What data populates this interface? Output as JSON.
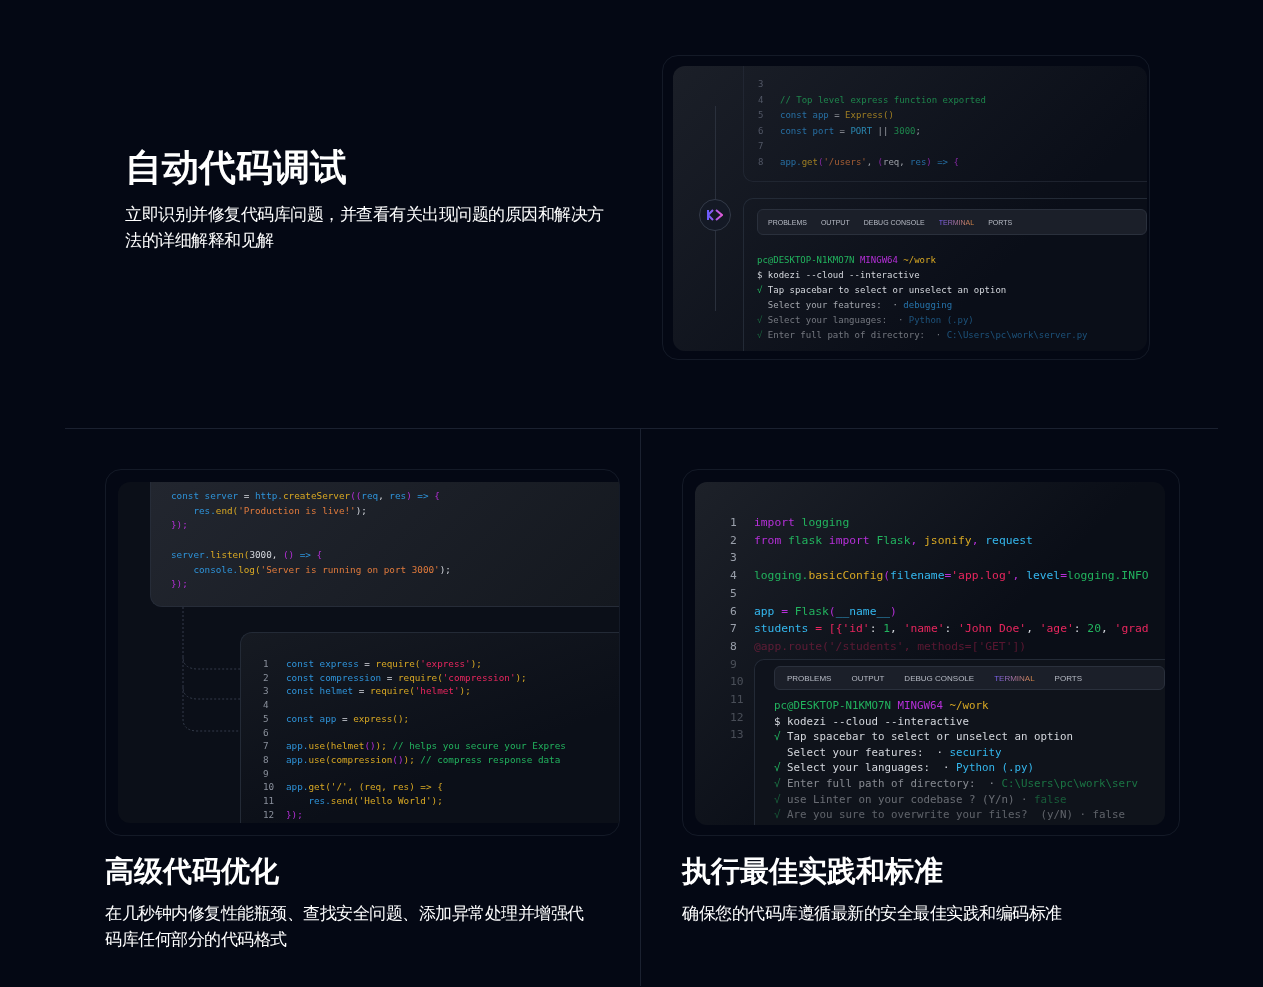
{
  "debugging": {
    "title": "自动代码调试",
    "description": "立即识别并修复代码库问题，并查看有关出现问题的原因和解决方法的详细解释和见解",
    "editor": {
      "lines": [
        {
          "number": "3"
        },
        {
          "number": "4",
          "tokens": [
            {
              "text": "// Top level express function exported",
              "kind": "comment"
            }
          ]
        },
        {
          "number": "5",
          "tokens": [
            {
              "text": "const app",
              "kind": "keyword"
            },
            {
              "text": " = ",
              "kind": "plain"
            },
            {
              "text": "Express()",
              "kind": "call"
            }
          ]
        },
        {
          "number": "6",
          "tokens": [
            {
              "text": "const port",
              "kind": "keyword"
            },
            {
              "text": " = ",
              "kind": "plain"
            },
            {
              "text": "PORT",
              "kind": "variable"
            },
            {
              "text": " || ",
              "kind": "plain"
            },
            {
              "text": "3000",
              "kind": "comment"
            },
            {
              "text": ";",
              "kind": "plain"
            }
          ]
        },
        {
          "number": "7"
        },
        {
          "number": "8",
          "tokens": [
            {
              "text": "app.",
              "kind": "keyword"
            },
            {
              "text": "get",
              "kind": "call"
            },
            {
              "text": "(",
              "kind": "bracket"
            },
            {
              "text": "'/users'",
              "kind": "string"
            },
            {
              "text": ", ",
              "kind": "plain"
            },
            {
              "text": "(",
              "kind": "bracket"
            },
            {
              "text": "req, ",
              "kind": "plain"
            },
            {
              "text": "res",
              "kind": "keyword"
            },
            {
              "text": ") ",
              "kind": "bracket"
            },
            {
              "text": "=> ",
              "kind": "keyword"
            },
            {
              "text": "{",
              "kind": "bracket"
            }
          ]
        }
      ]
    },
    "terminal": {
      "tabs": [
        {
          "label": "PROBLEMS",
          "selected": false
        },
        {
          "label": "OUTPUT",
          "selected": false
        },
        {
          "label": "DEBUG CONSOLE",
          "selected": false
        },
        {
          "label": "TERMINAL",
          "selected": true
        },
        {
          "label": "PORTS",
          "selected": false
        }
      ],
      "lines": [
        {
          "tokens": [
            {
              "text": "pc@DESKTOP-N1KMO7N ",
              "kind": "comment"
            },
            {
              "text": "MINGW64 ",
              "kind": "bracket"
            },
            {
              "text": "~/work",
              "kind": "call"
            }
          ]
        },
        {
          "tokens": [
            {
              "text": "$ kodezi --cloud --interactive",
              "kind": "plain"
            }
          ]
        },
        {
          "tokens": [
            {
              "text": "√ ",
              "kind": "comment"
            },
            {
              "text": "Tap spacebar to select or unselect an option",
              "kind": "plain"
            }
          ]
        },
        {
          "tokens": [
            {
              "text": "  Select your features:  · ",
              "kind": "plain"
            },
            {
              "text": "debugging",
              "kind": "keyword"
            }
          ]
        },
        {
          "tokens": [
            {
              "text": "√ ",
              "kind": "comment"
            },
            {
              "text": "Select your languages:  · ",
              "kind": "plain"
            },
            {
              "text": "Python (.py)",
              "kind": "keyword"
            }
          ]
        },
        {
          "tokens": [
            {
              "text": "√ ",
              "kind": "comment"
            },
            {
              "text": "Enter full path of directory:  · ",
              "kind": "plain"
            },
            {
              "text": "C:\\Users\\pc\\work\\server.py",
              "kind": "keyword"
            }
          ]
        }
      ]
    }
  },
  "optimization": {
    "title": "高级代码优化",
    "description": "在几秒钟内修复性能瓶颈、查找安全问题、添加异常处理并增强代码库任何部分的代码格式",
    "server_snippet": {
      "blocks": [
        {
          "lines": [
            {
              "tokens": [
                {
                  "text": "const server",
                  "kind": "keyword"
                },
                {
                  "text": " = ",
                  "kind": "plain"
                },
                {
                  "text": "http.",
                  "kind": "keyword"
                },
                {
                  "text": "createServer",
                  "kind": "call"
                },
                {
                  "text": "((",
                  "kind": "bracket"
                },
                {
                  "text": "req",
                  "kind": "keyword"
                },
                {
                  "text": ", ",
                  "kind": "plain"
                },
                {
                  "text": "res",
                  "kind": "keyword"
                },
                {
                  "text": ") ",
                  "kind": "bracket"
                },
                {
                  "text": "=> ",
                  "kind": "keyword"
                },
                {
                  "text": "{",
                  "kind": "bracket"
                }
              ]
            },
            {
              "tokens": [
                {
                  "text": "    res.",
                  "kind": "keyword"
                },
                {
                  "text": "end(",
                  "kind": "call"
                },
                {
                  "text": "'Production is live!'",
                  "kind": "string"
                },
                {
                  "text": ");",
                  "kind": "plain"
                }
              ]
            },
            {
              "tokens": [
                {
                  "text": "});",
                  "kind": "bracket"
                }
              ]
            }
          ]
        },
        {
          "lines": [
            {
              "tokens": [
                {
                  "text": "server.",
                  "kind": "keyword"
                },
                {
                  "text": "listen(",
                  "kind": "call"
                },
                {
                  "text": "3000, ",
                  "kind": "plain"
                },
                {
                  "text": "() ",
                  "kind": "bracket"
                },
                {
                  "text": "=> ",
                  "kind": "keyword"
                },
                {
                  "text": "{",
                  "kind": "bracket"
                }
              ]
            },
            {
              "tokens": [
                {
                  "text": "    console.",
                  "kind": "keyword"
                },
                {
                  "text": "log(",
                  "kind": "call"
                },
                {
                  "text": "'Server is running on port 3000'",
                  "kind": "string"
                },
                {
                  "text": ");",
                  "kind": "plain"
                }
              ]
            },
            {
              "tokens": [
                {
                  "text": "});",
                  "kind": "bracket"
                }
              ]
            }
          ]
        }
      ]
    },
    "editor": {
      "lines": [
        {
          "number": "1",
          "tokens": [
            {
              "text": "const express",
              "kind": "keyword"
            },
            {
              "text": " = ",
              "kind": "plain"
            },
            {
              "text": "require(",
              "kind": "call"
            },
            {
              "text": "'express'",
              "kind": "literal"
            },
            {
              "text": ");",
              "kind": "call"
            }
          ]
        },
        {
          "number": "2",
          "tokens": [
            {
              "text": "const compression",
              "kind": "keyword"
            },
            {
              "text": " = ",
              "kind": "plain"
            },
            {
              "text": "require(",
              "kind": "call"
            },
            {
              "text": "'compression'",
              "kind": "literal"
            },
            {
              "text": ");",
              "kind": "call"
            }
          ]
        },
        {
          "number": "3",
          "tokens": [
            {
              "text": "const helmet",
              "kind": "keyword"
            },
            {
              "text": " = ",
              "kind": "plain"
            },
            {
              "text": "require(",
              "kind": "call"
            },
            {
              "text": "'helmet'",
              "kind": "literal"
            },
            {
              "text": ");",
              "kind": "call"
            }
          ]
        },
        {
          "number": "4"
        },
        {
          "number": "5",
          "tokens": [
            {
              "text": "const app",
              "kind": "keyword"
            },
            {
              "text": " = ",
              "kind": "plain"
            },
            {
              "text": "express();",
              "kind": "call"
            }
          ]
        },
        {
          "number": "6"
        },
        {
          "number": "7",
          "tokens": [
            {
              "text": "app.",
              "kind": "keyword"
            },
            {
              "text": "use(helmet",
              "kind": "call"
            },
            {
              "text": "()",
              "kind": "bracket"
            },
            {
              "text": "); ",
              "kind": "call"
            },
            {
              "text": "// helps you secure your Expres",
              "kind": "comment"
            }
          ]
        },
        {
          "number": "8",
          "tokens": [
            {
              "text": "app.",
              "kind": "keyword"
            },
            {
              "text": "use(compression",
              "kind": "call"
            },
            {
              "text": "()",
              "kind": "bracket"
            },
            {
              "text": "); ",
              "kind": "call"
            },
            {
              "text": "// compress response data",
              "kind": "comment"
            }
          ]
        },
        {
          "number": "9"
        },
        {
          "number": "10",
          "tokens": [
            {
              "text": "app.",
              "kind": "keyword"
            },
            {
              "text": "get('/', (req, res) => {",
              "kind": "call"
            }
          ]
        },
        {
          "number": "11",
          "tokens": [
            {
              "text": "    res.",
              "kind": "keyword"
            },
            {
              "text": "send('Hello World');",
              "kind": "call"
            }
          ]
        },
        {
          "number": "12",
          "tokens": [
            {
              "text": "});",
              "kind": "bracket"
            }
          ]
        }
      ]
    }
  },
  "standards": {
    "title": "执行最佳实践和标准",
    "description": "确保您的代码库遵循最新的安全最佳实践和编码标准",
    "editor": {
      "lines": [
        {
          "number": "1",
          "tokens": [
            {
              "text": "import ",
              "kind": "bracket"
            },
            {
              "text": "logging",
              "kind": "comment"
            }
          ]
        },
        {
          "number": "2",
          "tokens": [
            {
              "text": "from ",
              "kind": "bracket"
            },
            {
              "text": "flask ",
              "kind": "comment"
            },
            {
              "text": "import ",
              "kind": "bracket"
            },
            {
              "text": "Flask",
              "kind": "comment"
            },
            {
              "text": ", ",
              "kind": "bracket"
            },
            {
              "text": "jsonify",
              "kind": "call"
            },
            {
              "text": ", ",
              "kind": "bracket"
            },
            {
              "text": "request",
              "kind": "variable"
            }
          ]
        },
        {
          "number": "3"
        },
        {
          "number": "4",
          "tokens": [
            {
              "text": "logging.",
              "kind": "comment"
            },
            {
              "text": "basicConfig",
              "kind": "call"
            },
            {
              "text": "(",
              "kind": "bracket"
            },
            {
              "text": "filename",
              "kind": "variable"
            },
            {
              "text": "=",
              "kind": "bracket"
            },
            {
              "text": "'app.log'",
              "kind": "literal"
            },
            {
              "text": ", ",
              "kind": "bracket"
            },
            {
              "text": "level",
              "kind": "variable"
            },
            {
              "text": "=",
              "kind": "bracket"
            },
            {
              "text": "logging.INFO",
              "kind": "comment"
            }
          ]
        },
        {
          "number": "5"
        },
        {
          "number": "6",
          "tokens": [
            {
              "text": "app",
              "kind": "variable"
            },
            {
              "text": " = ",
              "kind": "bracket"
            },
            {
              "text": "Flask",
              "kind": "comment"
            },
            {
              "text": "(",
              "kind": "bracket"
            },
            {
              "text": "__name__",
              "kind": "variable"
            },
            {
              "text": ")",
              "kind": "bracket"
            }
          ]
        },
        {
          "number": "7",
          "tokens": [
            {
              "text": "students",
              "kind": "variable"
            },
            {
              "text": " = [{",
              "kind": "literal"
            },
            {
              "text": "'id'",
              "kind": "literal"
            },
            {
              "text": ": ",
              "kind": "plain"
            },
            {
              "text": "1",
              "kind": "comment"
            },
            {
              "text": ", ",
              "kind": "plain"
            },
            {
              "text": "'name'",
              "kind": "literal"
            },
            {
              "text": ": ",
              "kind": "plain"
            },
            {
              "text": "'John Doe'",
              "kind": "literal"
            },
            {
              "text": ", ",
              "kind": "plain"
            },
            {
              "text": "'age'",
              "kind": "literal"
            },
            {
              "text": ": ",
              "kind": "plain"
            },
            {
              "text": "20",
              "kind": "comment"
            },
            {
              "text": ", ",
              "kind": "plain"
            },
            {
              "text": "'grad",
              "kind": "literal"
            }
          ]
        },
        {
          "number": "8",
          "tokens": [
            {
              "text": "@app.route('/students', methods=['GET'])",
              "kind": "literal"
            }
          ]
        },
        {
          "number": "9"
        },
        {
          "number": "10"
        },
        {
          "number": "11"
        },
        {
          "number": "12"
        },
        {
          "number": "13"
        }
      ]
    },
    "terminal": {
      "tabs": [
        {
          "label": "PROBLEMS",
          "selected": false
        },
        {
          "label": "OUTPUT",
          "selected": false
        },
        {
          "label": "DEBUG CONSOLE",
          "selected": false
        },
        {
          "label": "TERMINAL",
          "selected": true
        },
        {
          "label": "PORTS",
          "selected": false
        }
      ],
      "lines": [
        {
          "tokens": [
            {
              "text": "pc@DESKTOP-N1KMO7N ",
              "kind": "comment"
            },
            {
              "text": "MINGW64 ",
              "kind": "bracket"
            },
            {
              "text": "~/work",
              "kind": "call"
            }
          ]
        },
        {
          "tokens": [
            {
              "text": "$ kodezi --cloud --interactive",
              "kind": "plain"
            }
          ]
        },
        {
          "tokens": [
            {
              "text": "√ ",
              "kind": "comment"
            },
            {
              "text": "Tap spacebar to select or unselect an option",
              "kind": "plain"
            }
          ]
        },
        {
          "tokens": [
            {
              "text": "  Select your features:  · ",
              "kind": "plain"
            },
            {
              "text": "security",
              "kind": "variable"
            }
          ]
        },
        {
          "tokens": [
            {
              "text": "√ ",
              "kind": "comment"
            },
            {
              "text": "Select your languages:  · ",
              "kind": "plain"
            },
            {
              "text": "Python (.py)",
              "kind": "variable"
            }
          ]
        },
        {
          "tokens": [
            {
              "text": "√ ",
              "kind": "comment"
            },
            {
              "text": "Enter full path of directory:  · ",
              "kind": "plain"
            },
            {
              "text": "C:\\Users\\pc\\work\\serv",
              "kind": "comment"
            }
          ]
        },
        {
          "tokens": [
            {
              "text": "√ ",
              "kind": "comment"
            },
            {
              "text": "use Linter on your codebase ? (Y/n) · ",
              "kind": "plain"
            },
            {
              "text": "false",
              "kind": "comment"
            }
          ]
        },
        {
          "tokens": [
            {
              "text": "√ ",
              "kind": "comment"
            },
            {
              "text": "Are you sure to overwrite your files?  (y/N) · ",
              "kind": "plain"
            },
            {
              "text": "false",
              "kind": "plain"
            }
          ]
        }
      ]
    }
  }
}
